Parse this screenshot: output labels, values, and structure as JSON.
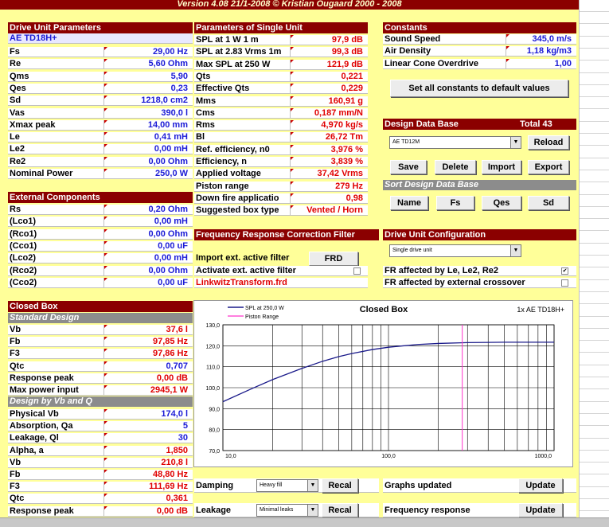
{
  "title": "Version 4.08  21/1-2008      © Kristian Ougaard  2000 - 2008",
  "drive_unit": {
    "header": "Drive Unit Parameters",
    "name": "AE TD18H+",
    "rows": [
      {
        "label": "Fs",
        "value": "29,00 Hz"
      },
      {
        "label": "Re",
        "value": "5,60 Ohm"
      },
      {
        "label": "Qms",
        "value": "5,90"
      },
      {
        "label": "Qes",
        "value": "0,23"
      },
      {
        "label": "Sd",
        "value": "1218,0 cm2"
      },
      {
        "label": "Vas",
        "value": "390,0 l"
      },
      {
        "label": "Xmax peak",
        "value": "14,00 mm"
      },
      {
        "label": "Le",
        "value": "0,41 mH"
      },
      {
        "label": "Le2",
        "value": "0,00 mH"
      },
      {
        "label": "Re2",
        "value": "0,00 Ohm"
      },
      {
        "label": "Nominal Power",
        "value": "250,0 W"
      }
    ]
  },
  "external": {
    "header": "External Components",
    "rows": [
      {
        "label": "Rs",
        "value": "0,20 Ohm"
      },
      {
        "label": "(Lco1)",
        "value": "0,00 mH"
      },
      {
        "label": "(Rco1)",
        "value": "0,00 Ohm"
      },
      {
        "label": "(Cco1)",
        "value": "0,00 uF"
      },
      {
        "label": "(Lco2)",
        "value": "0,00 mH"
      },
      {
        "label": "(Rco2)",
        "value": "0,00 Ohm"
      },
      {
        "label": "(Cco2)",
        "value": "0,00 uF"
      }
    ]
  },
  "closed_box": {
    "header": "Closed Box",
    "standard_header": "Standard Design",
    "standard_rows": [
      {
        "label": "Vb",
        "value": "37,6 l"
      },
      {
        "label": "Fb",
        "value": "97,85 Hz"
      },
      {
        "label": "F3",
        "value": "97,86 Hz"
      },
      {
        "label": "Qtc",
        "value": "0,707"
      },
      {
        "label": "Response peak",
        "value": "0,00 dB"
      },
      {
        "label": "Max power input",
        "value": "2945,1 W"
      }
    ],
    "vbq_header": "Design by Vb and Q",
    "vbq_rows": [
      {
        "label": "Physical Vb",
        "value": "174,0 l"
      },
      {
        "label": "Absorption, Qa",
        "value": "5"
      },
      {
        "label": "Leakage, Ql",
        "value": "30"
      },
      {
        "label": "Alpha, a",
        "value": "1,850"
      },
      {
        "label": "Vb",
        "value": "210,8 l"
      },
      {
        "label": "Fb",
        "value": "48,80 Hz"
      },
      {
        "label": "F3",
        "value": "111,69 Hz"
      },
      {
        "label": "Qtc",
        "value": "0,361"
      },
      {
        "label": "Response peak",
        "value": "0,00 dB"
      }
    ]
  },
  "single_unit": {
    "header": "Parameters of Single Unit",
    "rows": [
      {
        "label": "SPL at 1 W 1 m",
        "value": "97,9 dB"
      },
      {
        "label": "SPL at 2.83 Vrms 1m",
        "value": "99,3 dB"
      },
      {
        "label": "Max SPL at 250 W",
        "value": "121,9 dB"
      },
      {
        "label": "Qts",
        "value": "0,221"
      },
      {
        "label": "Effective Qts",
        "value": "0,229"
      },
      {
        "label": "Mms",
        "value": "160,91 g"
      },
      {
        "label": "Cms",
        "value": "0,187 mm/N"
      },
      {
        "label": "Rms",
        "value": "4,970 kg/s"
      },
      {
        "label": "Bl",
        "value": "26,72 Tm"
      },
      {
        "label": "Ref. efficiency, n0",
        "value": "3,976 %"
      },
      {
        "label": "Efficiency, n",
        "value": "3,839 %"
      },
      {
        "label": "Applied voltage",
        "value": "37,42 Vrms"
      },
      {
        "label": "Piston range",
        "value": "279 Hz"
      },
      {
        "label": "Down fire applicatio",
        "value": "0,98"
      },
      {
        "label": "Suggested box type",
        "value": "Vented / Horn"
      }
    ]
  },
  "freq_corr": {
    "header": "Frequency Response Correction Filter",
    "import_label": "Import ext. active filter",
    "frd_button": "FRD",
    "activate_label": "Activate ext. active filter",
    "filter_file": "LinkwitzTransform.frd"
  },
  "constants": {
    "header": "Constants",
    "rows": [
      {
        "label": "Sound Speed",
        "value": "345,0 m/s"
      },
      {
        "label": "Air Density",
        "value": "1,18 kg/m3"
      },
      {
        "label": "Linear Cone Overdrive",
        "value": "1,00"
      }
    ],
    "default_button": "Set all constants to default values"
  },
  "database": {
    "header": "Design Data Base",
    "total": "Total 43",
    "selected": "AE TD12M",
    "reload": "Reload",
    "save": "Save",
    "delete": "Delete",
    "import": "Import",
    "export": "Export",
    "sort_header": "Sort Design Data Base",
    "sort_name": "Name",
    "sort_fs": "Fs",
    "sort_qes": "Qes",
    "sort_sd": "Sd"
  },
  "config": {
    "header": "Drive Unit Configuration",
    "selected": "Single drive unit",
    "fr_le": "FR affected by Le, Le2, Re2",
    "fr_crossover": "FR affected by external crossover",
    "fr_le_checked": "✔",
    "fr_crossover_checked": ""
  },
  "bottom": {
    "damping_label": "Damping",
    "damping_value": "Heavy fill",
    "recal1": "Recal",
    "leakage_label": "Leakage",
    "leakage_value": "Minimal leaks",
    "recal2": "Recal",
    "graphs_label": "Graphs updated",
    "update1": "Update",
    "freq_label": "Frequency response",
    "update2": "Update"
  },
  "chart_data": {
    "type": "line",
    "title": "Closed Box",
    "subtitle": "1x AE TD18H+",
    "xscale": "log",
    "xlim": [
      10,
      1000
    ],
    "ylim": [
      70,
      130
    ],
    "yticks": [
      "130,0",
      "120,0",
      "110,0",
      "100,0",
      "90,0",
      "80,0",
      "70,0"
    ],
    "xticks": [
      "10,0",
      "100,0",
      "1000,0"
    ],
    "series": [
      {
        "name": "SPL at 250,0 W",
        "color": "#1a1a8a",
        "x": [
          10,
          15,
          20,
          30,
          40,
          50,
          60,
          80,
          100,
          150,
          200,
          300,
          400,
          500,
          700,
          1000
        ],
        "y": [
          93.3,
          99.6,
          103.9,
          109.2,
          112.6,
          114.8,
          116.3,
          118.2,
          119.3,
          120.6,
          121.1,
          121.5,
          121.6,
          121.7,
          121.7,
          121.7
        ]
      },
      {
        "name": "Piston Range",
        "color": "#ff33cc",
        "x": [
          279,
          279
        ],
        "y": [
          70,
          130
        ]
      }
    ],
    "grid": true,
    "legend": "top-left"
  }
}
